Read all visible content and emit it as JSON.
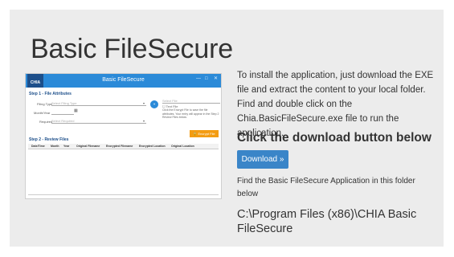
{
  "page": {
    "title": "Basic FileSecure",
    "description": "To install the application, just download the EXE file and extract the content to your local folder. Find and double click on the Chia.BasicFileSecure.exe file to run the application.",
    "download_heading": "Click the download button below",
    "download_button": "Download »",
    "find_text": "Find the Basic FileSecure Application in this folder below",
    "install_path": "C:\\Program Files (x86)\\CHIA Basic FileSecure"
  },
  "app_screenshot": {
    "logo": "CHIA",
    "window_title": "Basic FileSecure",
    "window_controls": [
      "—",
      "□",
      "✕"
    ],
    "step1_title": "Step 1 - File Attributes",
    "filing_type_label": "Filing Type",
    "filing_type_value": "Select Filing Type",
    "month_year_label": "Month/Year",
    "required_label": "Required",
    "required_value": "Select Required",
    "select_file_label": "Select File",
    "text_file_label": "Text File",
    "note": "Click the Encrypt File to save the file attributes. Your entry will appear in the Step 2 Review Files below.",
    "encrypt_button": "Encrypt File",
    "step2_title": "Step 2 - Review Files",
    "columns": [
      "Date/Time",
      "Month",
      "Year",
      "Original Filename",
      "Encrypted Filename",
      "Encrypted Location",
      "Original Location"
    ]
  },
  "colors": {
    "panel_bg": "#ececec",
    "accent_blue": "#2b8ad8",
    "download_button": "#3a85c8",
    "encrypt_orange": "#f39c12"
  }
}
